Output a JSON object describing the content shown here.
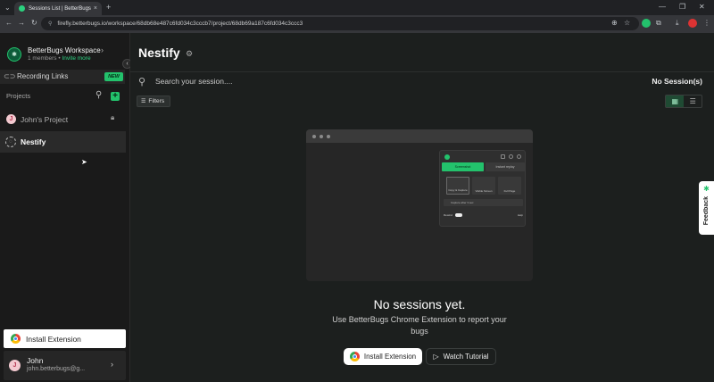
{
  "browser": {
    "tab_title": "Sessions List | BetterBugs",
    "url": "firefly.betterbugs.io/workspace/68db68e487c6fd034c3cccb7/project/68db69a187c6fd034c3ccc3"
  },
  "sidebar": {
    "workspace_name": "BetterBugs Workspace",
    "members": "1 members",
    "separator": "•",
    "invite": "Invite more",
    "recording_links": "Recording Links",
    "new_badge": "NEW",
    "projects_label": "Projects",
    "projects": [
      {
        "avatar": "J",
        "name": "John's Project",
        "locked": true
      },
      {
        "avatar": "",
        "name": "Nestify",
        "selected": true
      }
    ],
    "install_extension": "Install Extension",
    "user": {
      "avatar": "J",
      "name": "John",
      "email": "john.betterbugs@g..."
    }
  },
  "main": {
    "title": "Nestify",
    "search_placeholder": "Search your session....",
    "session_count": "No Session(s)",
    "filters": "Filters",
    "empty_state": {
      "title": "No sessions yet.",
      "description": "Use BetterBugs Chrome Extension to report your bugs",
      "install_button": "Install Extension",
      "tutorial_button": "Watch Tutorial"
    },
    "illustration": {
      "tab_screenshot": "Screenshot",
      "tab_record": "Instant replay",
      "opt_visible": "Copy & Capture",
      "opt_full": "Visible Screen",
      "opt_area": "Full Page",
      "capture_label": "Capture after 3 sec",
      "footer_left": "Rewind",
      "footer_right": "Help"
    }
  },
  "feedback": "Feedback",
  "colors": {
    "accent": "#23c26c",
    "background": "#1c1f1e",
    "sidebar": "#1a1a1a"
  }
}
